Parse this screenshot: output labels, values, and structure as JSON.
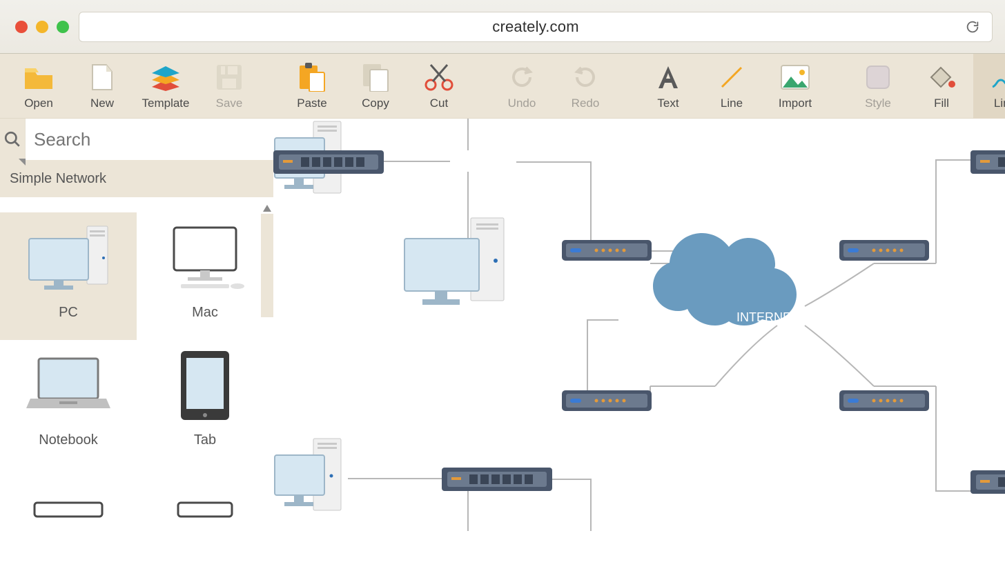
{
  "browser": {
    "url": "creately.com"
  },
  "toolbar": {
    "open": "Open",
    "new": "New",
    "template": "Template",
    "save": "Save",
    "paste": "Paste",
    "copy": "Copy",
    "cut": "Cut",
    "undo": "Undo",
    "redo": "Redo",
    "text": "Text",
    "line": "Line",
    "import": "Import",
    "style": "Style",
    "fill": "Fill",
    "line2": "Line"
  },
  "search": {
    "placeholder": "Search"
  },
  "category": "Simple Network",
  "shapes": [
    {
      "name": "PC"
    },
    {
      "name": "Mac"
    },
    {
      "name": "Notebook"
    },
    {
      "name": "Tab"
    }
  ],
  "canvas": {
    "cloud_label": "INTERNET"
  },
  "colors": {
    "toolbar_bg": "#ece5d7",
    "accent_orange": "#f4a623",
    "accent_red": "#e14e3a",
    "accent_blue": "#6a9bbf",
    "device_dark": "#49566b",
    "device_light": "#6c7a8e",
    "pale_blue": "#cfe3ee"
  }
}
